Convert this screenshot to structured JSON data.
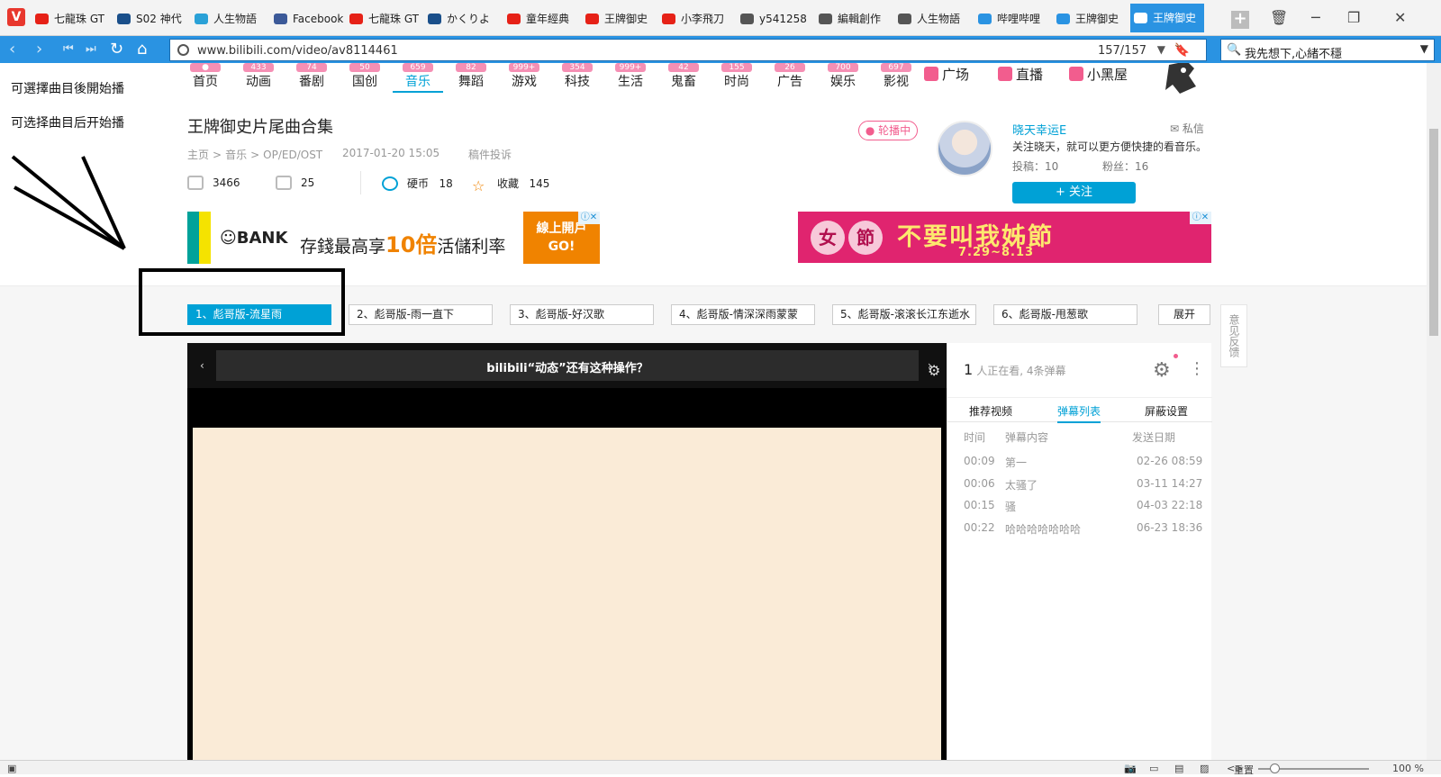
{
  "browser": {
    "tabs": [
      {
        "label": "七龍珠 GT",
        "icon_color": "#e62117"
      },
      {
        "label": "S02 神代",
        "icon_color": "#1a4f8a"
      },
      {
        "label": "人生物語",
        "icon_color": "#2aa1d7"
      },
      {
        "label": "Facebook",
        "icon_color": "#3b5998"
      },
      {
        "label": "七龍珠 GT",
        "icon_color": "#e62117"
      },
      {
        "label": "かくりよ",
        "icon_color": "#1a4f8a"
      },
      {
        "label": "童年經典",
        "icon_color": "#e62117"
      },
      {
        "label": "王牌御史",
        "icon_color": "#e62117"
      },
      {
        "label": "小李飛刀",
        "icon_color": "#e62117"
      },
      {
        "label": "y541258",
        "icon_color": "#555555"
      },
      {
        "label": "編輯創作",
        "icon_color": "#555555"
      },
      {
        "label": "人生物語",
        "icon_color": "#555555"
      },
      {
        "label": "哔哩哔哩",
        "icon_color": "#2a93e2"
      },
      {
        "label": "王牌御史",
        "icon_color": "#2a93e2"
      },
      {
        "label": "王牌御史",
        "icon_color": "#ffffff"
      }
    ],
    "url": "www.bilibili.com/video/av8114461",
    "url_counter": "157/157",
    "search_value": "我先想下,心緒不穩"
  },
  "annotations": {
    "note_trad": "可選擇曲目後開始播",
    "note_simp": "可选择曲目后开始播"
  },
  "nav": {
    "categories": [
      {
        "label": "首页",
        "count": "●"
      },
      {
        "label": "动画",
        "count": "433"
      },
      {
        "label": "番剧",
        "count": "74"
      },
      {
        "label": "国创",
        "count": "50"
      },
      {
        "label": "音乐",
        "count": "659"
      },
      {
        "label": "舞蹈",
        "count": "82"
      },
      {
        "label": "游戏",
        "count": "999+"
      },
      {
        "label": "科技",
        "count": "354"
      },
      {
        "label": "生活",
        "count": "999+"
      },
      {
        "label": "鬼畜",
        "count": "42"
      },
      {
        "label": "时尚",
        "count": "155"
      },
      {
        "label": "广告",
        "count": "26"
      },
      {
        "label": "娱乐",
        "count": "700"
      },
      {
        "label": "影视",
        "count": "697"
      }
    ],
    "active_index": 4,
    "links": [
      {
        "label": "广场",
        "icon_color": "#f25d8e"
      },
      {
        "label": "直播",
        "icon_color": "#f25d8e"
      },
      {
        "label": "小黑屋",
        "icon_color": "#f25d8e"
      }
    ]
  },
  "video": {
    "title": "王牌御史片尾曲合集",
    "breadcrumb": [
      "主页",
      ">",
      "音乐",
      ">",
      "OP/ED/OST"
    ],
    "date": "2017-01-20 15:05",
    "report": "稿件投诉",
    "plays": "3466",
    "danmaku_count": "25",
    "coins_label": "硬币",
    "coins": "18",
    "fav_label": "收藏",
    "favs": "145"
  },
  "uploader": {
    "badge": "● 轮播中",
    "name": "晓天幸运E",
    "message": "私信",
    "desc": "关注晓天，就可以更方便快捷的看音乐。",
    "posts_label": "投稿：10",
    "fans_label": "粉丝：16",
    "follow": "+ 关注"
  },
  "ads": {
    "bank_name": "BANK",
    "bank_copy_a": "存錢最高享",
    "bank_copy_big": "10倍",
    "bank_copy_b": "活儲利率",
    "bank_cta_1": "線上開戶",
    "bank_cta_2": "GO!",
    "promo_c1": "女",
    "promo_c2": "節",
    "promo_head": "不要叫我姊節",
    "promo_date": "7.29~8.13",
    "ad_mark": "ⓘ✕"
  },
  "parts": [
    "1、彪哥版-流星雨",
    "2、彪哥版-雨一直下",
    "3、彪哥版-好汉歌",
    "4、彪哥版-情深深雨蒙蒙",
    "5、彪哥版-滚滚长江东逝水",
    "6、彪哥版-甩葱歌"
  ],
  "expand_label": "展开",
  "feedback_label": "意见反馈",
  "player": {
    "banner": "bilibili“动态”还有这种操作？"
  },
  "danmaku": {
    "viewers": "1",
    "viewers_text": "人正在看, 4条弹幕",
    "tabs": [
      "推荐视频",
      "弹幕列表",
      "屏蔽设置"
    ],
    "active_tab": 1,
    "headers": [
      "时间",
      "弹幕内容",
      "发送日期"
    ],
    "rows": [
      {
        "time": "00:09",
        "text": "第一",
        "date": "02-26 08:59"
      },
      {
        "time": "00:06",
        "text": "太骚了",
        "date": "03-11 14:27"
      },
      {
        "time": "00:15",
        "text": "骚",
        "date": "04-03 22:18"
      },
      {
        "time": "00:22",
        "text": "哈哈哈哈哈哈哈",
        "date": "06-23 18:36"
      }
    ]
  },
  "status": {
    "reset_label": "重置",
    "zoom": "100 %",
    "zoom_fraction": 0.15
  }
}
